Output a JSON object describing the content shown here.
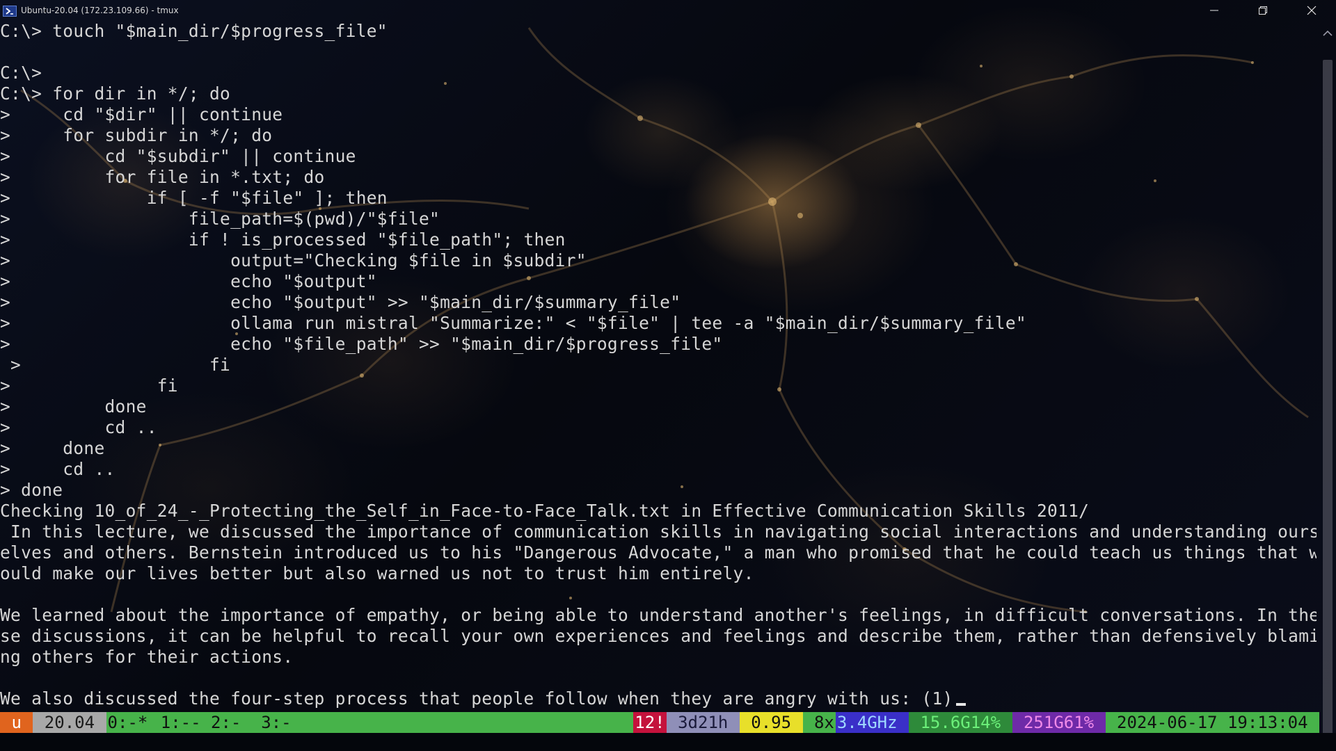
{
  "window": {
    "title": "Ubuntu-20.04 (172.23.109.66) - tmux"
  },
  "terminal": {
    "lines": [
      "C:\\> touch \"$main_dir/$progress_file\"",
      "",
      "C:\\>",
      "C:\\> for dir in */; do",
      ">     cd \"$dir\" || continue",
      ">     for subdir in */; do",
      ">         cd \"$subdir\" || continue",
      ">         for file in *.txt; do",
      ">             if [ -f \"$file\" ]; then",
      ">                 file_path=$(pwd)/\"$file\"",
      ">                 if ! is_processed \"$file_path\"; then",
      ">                     output=\"Checking $file in $subdir\"",
      ">                     echo \"$output\"",
      ">                     echo \"$output\" >> \"$main_dir/$summary_file\"",
      ">                     ollama run mistral \"Summarize:\" < \"$file\" | tee -a \"$main_dir/$summary_file\"",
      ">                     echo \"$file_path\" >> \"$main_dir/$progress_file\"",
      " >                  fi",
      ">              fi",
      ">         done",
      ">         cd ..",
      ">     done",
      ">     cd ..",
      "> done",
      "Checking 10_of_24_-_Protecting_the_Self_in_Face-to-Face_Talk.txt in Effective Communication Skills 2011/",
      " In this lecture, we discussed the importance of communication skills in navigating social interactions and understanding ours",
      "elves and others. Bernstein introduced us to his \"Dangerous Advocate,\" a man who promised that he could teach us things that w",
      "ould make our lives better but also warned us not to trust him entirely.",
      "",
      "We learned about the importance of empathy, or being able to understand another's feelings, in difficult conversations. In the",
      "se discussions, it can be helpful to recall your own experiences and feelings and describe them, rather than defensively blami",
      "ng others for their actions.",
      "",
      "We also discussed the four-step process that people follow when they are angry with us: (1)"
    ]
  },
  "statusbar": {
    "segments": [
      {
        "text": " u ",
        "bg": "#e0641e",
        "fg": "#ffffff"
      },
      {
        "text": " 20.04 ",
        "bg": "#a8a8a8",
        "fg": "#1a1a1a"
      },
      {
        "text": "0:-*",
        "bg": "#47b34a",
        "fg": "#111111"
      },
      {
        "text": " 1:-- 2:-  3:-",
        "bg": "#47b34a",
        "fg": "#111111"
      },
      {
        "text": "",
        "bg": "#47b34a",
        "fg": "#111111",
        "grow": true
      },
      {
        "text": "12!",
        "bg": "#c4123c",
        "fg": "#ffffff"
      },
      {
        "text": " 3d21h ",
        "bg": "#8f8fb8",
        "fg": "#1a1a3a"
      },
      {
        "text": " 0.95 ",
        "bg": "#e8df2a",
        "fg": "#111111"
      },
      {
        "text": " 8x",
        "bg": "#47b34a",
        "fg": "#111111"
      },
      {
        "text": "3.4GHz ",
        "bg": "#3a2fc8",
        "fg": "#9fd8ff"
      },
      {
        "text": " 15.6G14% ",
        "bg": "#2e8a3a",
        "fg": "#6cf07a"
      },
      {
        "text": " 251G61% ",
        "bg": "#6e2aa8",
        "fg": "#f08ae8"
      },
      {
        "text": " 2024-06-17 19:13:04 ",
        "bg": "#47b34a",
        "fg": "#111111"
      }
    ]
  },
  "icons": {
    "app": "terminal-app-icon",
    "minimize": "minimize-icon",
    "maximize": "restore-icon",
    "close": "close-icon",
    "scroll_up": "scroll-up-arrow-icon"
  },
  "colors": {
    "text": "#d6d6d6",
    "statusbar_green": "#47b34a"
  }
}
